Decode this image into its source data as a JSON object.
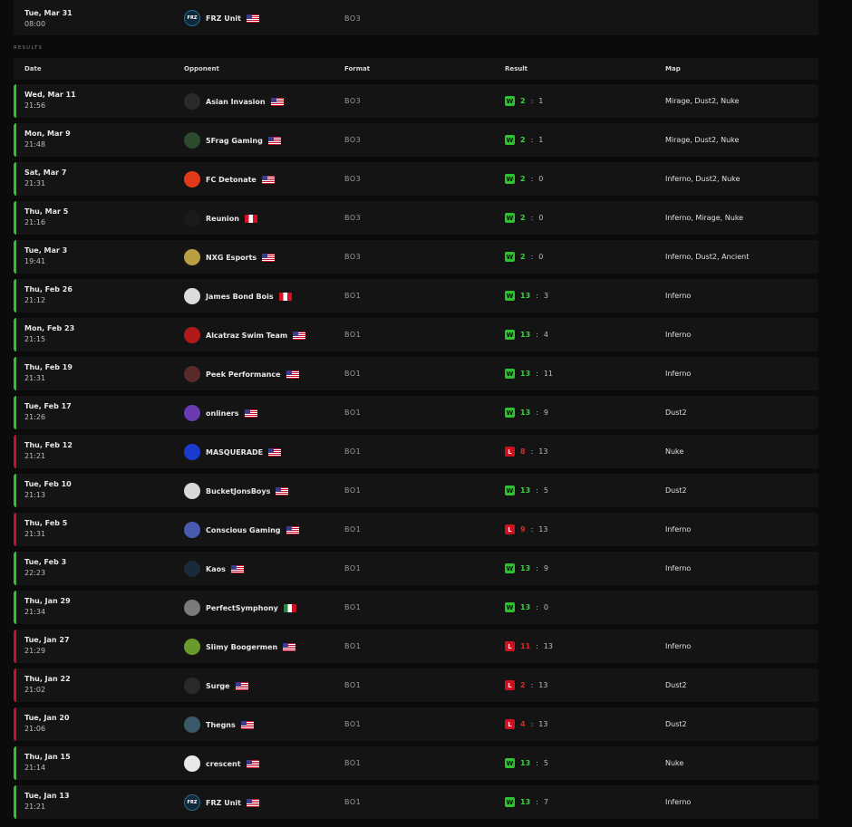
{
  "upcoming": {
    "date": "Tue, Mar 31",
    "time": "08:00",
    "opponent": "FRZ Unit",
    "logo_text": "FRZ",
    "flag": "us",
    "format": "BO3"
  },
  "section_title": "RESULTS",
  "columns": {
    "date": "Date",
    "opponent": "Opponent",
    "format": "Format",
    "result": "Result",
    "map": "Map"
  },
  "colors": {
    "win": "#2ec22e",
    "loss": "#d0101e",
    "row_bg": "#141414",
    "page_bg": "#0b0b0b"
  },
  "matches": [
    {
      "date": "Wed, Mar 11",
      "time": "21:56",
      "opponent": "Asian Invasion",
      "flag": "us",
      "format": "BO3",
      "result": "W",
      "score1": "2",
      "score2": "1",
      "map": "Mirage, Dust2, Nuke",
      "logo_color": "#2a2a2a",
      "logo_text": ""
    },
    {
      "date": "Mon, Mar 9",
      "time": "21:48",
      "opponent": "5Frag Gaming",
      "flag": "us",
      "format": "BO3",
      "result": "W",
      "score1": "2",
      "score2": "1",
      "map": "Mirage, Dust2, Nuke",
      "logo_color": "#2d4a2d",
      "logo_text": ""
    },
    {
      "date": "Sat, Mar 7",
      "time": "21:31",
      "opponent": "FC Detonate",
      "flag": "us",
      "format": "BO3",
      "result": "W",
      "score1": "2",
      "score2": "0",
      "map": "Inferno, Dust2, Nuke",
      "logo_color": "#e03a1a",
      "logo_text": ""
    },
    {
      "date": "Thu, Mar 5",
      "time": "21:16",
      "opponent": "Reunion",
      "flag": "pe",
      "format": "BO3",
      "result": "W",
      "score1": "2",
      "score2": "0",
      "map": "Inferno, Mirage, Nuke",
      "logo_color": "#1a1a1a",
      "logo_text": ""
    },
    {
      "date": "Tue, Mar 3",
      "time": "19:41",
      "opponent": "NXG Esports",
      "flag": "us",
      "format": "BO3",
      "result": "W",
      "score1": "2",
      "score2": "0",
      "map": "Inferno, Dust2, Ancient",
      "logo_color": "#b8a040",
      "logo_text": ""
    },
    {
      "date": "Thu, Feb 26",
      "time": "21:12",
      "opponent": "James Bond Bois",
      "flag": "pe",
      "format": "BO1",
      "result": "W",
      "score1": "13",
      "score2": "3",
      "map": "Inferno",
      "logo_color": "#dcdcdc",
      "logo_text": ""
    },
    {
      "date": "Mon, Feb 23",
      "time": "21:15",
      "opponent": "Alcatraz Swim Team",
      "flag": "us",
      "format": "BO1",
      "result": "W",
      "score1": "13",
      "score2": "4",
      "map": "Inferno",
      "logo_color": "#b01a1a",
      "logo_text": ""
    },
    {
      "date": "Thu, Feb 19",
      "time": "21:31",
      "opponent": "Peek Performance",
      "flag": "us",
      "format": "BO1",
      "result": "W",
      "score1": "13",
      "score2": "11",
      "map": "Inferno",
      "logo_color": "#5a2a2a",
      "logo_text": ""
    },
    {
      "date": "Tue, Feb 17",
      "time": "21:26",
      "opponent": "onliners",
      "flag": "us",
      "format": "BO1",
      "result": "W",
      "score1": "13",
      "score2": "9",
      "map": "Dust2",
      "logo_color": "#6a3ab0",
      "logo_text": ""
    },
    {
      "date": "Thu, Feb 12",
      "time": "21:21",
      "opponent": "MASQUERADE",
      "flag": "us",
      "format": "BO1",
      "result": "L",
      "score1": "8",
      "score2": "13",
      "map": "Nuke",
      "logo_color": "#1a3ad0",
      "logo_text": ""
    },
    {
      "date": "Tue, Feb 10",
      "time": "21:13",
      "opponent": "BucketJonsBoys",
      "flag": "us",
      "format": "BO1",
      "result": "W",
      "score1": "13",
      "score2": "5",
      "map": "Dust2",
      "logo_color": "#d8d8d8",
      "logo_text": ""
    },
    {
      "date": "Thu, Feb 5",
      "time": "21:31",
      "opponent": "Conscious Gaming",
      "flag": "us",
      "format": "BO1",
      "result": "L",
      "score1": "9",
      "score2": "13",
      "map": "Inferno",
      "logo_color": "#4a5ab0",
      "logo_text": ""
    },
    {
      "date": "Tue, Feb 3",
      "time": "22:23",
      "opponent": "Kaos",
      "flag": "us",
      "format": "BO1",
      "result": "W",
      "score1": "13",
      "score2": "9",
      "map": "Inferno",
      "logo_color": "#1a2a3a",
      "logo_text": ""
    },
    {
      "date": "Thu, Jan 29",
      "time": "21:34",
      "opponent": "PerfectSymphony",
      "flag": "mx",
      "format": "BO1",
      "result": "W",
      "score1": "13",
      "score2": "0",
      "map": "",
      "logo_color": "#7a7a7a",
      "logo_text": ""
    },
    {
      "date": "Tue, Jan 27",
      "time": "21:29",
      "opponent": "Slimy Boogermen",
      "flag": "us",
      "format": "BO1",
      "result": "L",
      "score1": "11",
      "score2": "13",
      "map": "Inferno",
      "logo_color": "#6a9a2a",
      "logo_text": ""
    },
    {
      "date": "Thu, Jan 22",
      "time": "21:02",
      "opponent": "Surge",
      "flag": "us",
      "format": "BO1",
      "result": "L",
      "score1": "2",
      "score2": "13",
      "map": "Dust2",
      "logo_color": "#2a2a2a",
      "logo_text": ""
    },
    {
      "date": "Tue, Jan 20",
      "time": "21:06",
      "opponent": "Thegns",
      "flag": "us",
      "format": "BO1",
      "result": "L",
      "score1": "4",
      "score2": "13",
      "map": "Dust2",
      "logo_color": "#3a5a6a",
      "logo_text": ""
    },
    {
      "date": "Thu, Jan 15",
      "time": "21:14",
      "opponent": "crescent",
      "flag": "us",
      "format": "BO1",
      "result": "W",
      "score1": "13",
      "score2": "5",
      "map": "Nuke",
      "logo_color": "#e8e8e8",
      "logo_text": ""
    },
    {
      "date": "Tue, Jan 13",
      "time": "21:21",
      "opponent": "FRZ Unit",
      "flag": "us",
      "format": "BO1",
      "result": "W",
      "score1": "13",
      "score2": "7",
      "map": "Inferno",
      "logo_color": "#0e2a3a",
      "logo_text": "FRZ"
    }
  ]
}
